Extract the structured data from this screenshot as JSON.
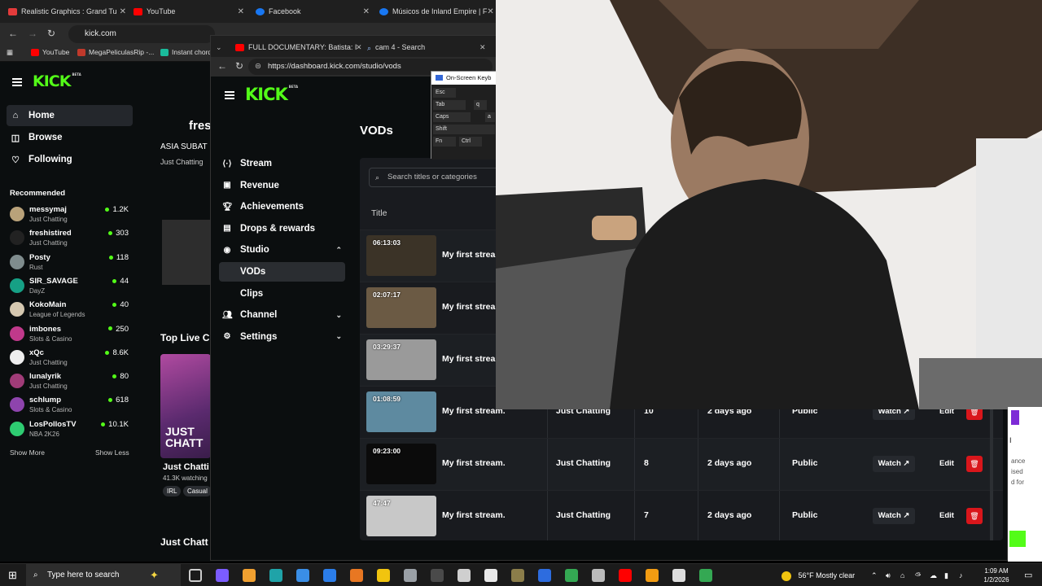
{
  "back_browser": {
    "tabs": [
      {
        "title": "Realistic Graphics : Grand Tu",
        "color": "#e33b3b"
      },
      {
        "title": "YouTube",
        "color": "#ff0000"
      },
      {
        "title": "Facebook",
        "color": "#1877f2"
      },
      {
        "title": "Músicos de Inland Empire | F",
        "color": "#1877f2"
      }
    ],
    "url": "kick.com",
    "bookmarks": [
      {
        "label": "YouTube",
        "color": "#ff0000"
      },
      {
        "label": "MegaPeliculasRip -...",
        "color": "#c0392b"
      },
      {
        "label": "Instant chord...",
        "color": "#1abc9c"
      }
    ],
    "nav": [
      {
        "label": "Home",
        "icon": "house-icon",
        "glyph": "⌂"
      },
      {
        "label": "Browse",
        "icon": "browse-icon",
        "glyph": "◫"
      },
      {
        "label": "Following",
        "icon": "heart-icon",
        "glyph": "♡"
      }
    ],
    "recommended_title": "Recommended",
    "recommended": [
      {
        "name": "messymaj",
        "category": "Just Chatting",
        "viewers": "1.2K",
        "color": "#b9a27a"
      },
      {
        "name": "freshistired",
        "category": "Just Chatting",
        "viewers": "303",
        "color": "#222222"
      },
      {
        "name": "Posty",
        "category": "Rust",
        "viewers": "118",
        "color": "#7f8c8d"
      },
      {
        "name": "SIR_SAVAGE",
        "category": "DayZ",
        "viewers": "44",
        "color": "#16a085"
      },
      {
        "name": "KokoMain",
        "category": "League of Legends",
        "viewers": "40",
        "color": "#d5c8b0"
      },
      {
        "name": "imbones",
        "category": "Slots & Casino",
        "viewers": "250",
        "color": "#c0398b"
      },
      {
        "name": "xQc",
        "category": "Just Chatting",
        "viewers": "8.6K",
        "color": "#eeeeee"
      },
      {
        "name": "lunalyrik",
        "category": "Just Chatting",
        "viewers": "80",
        "color": "#a03c78"
      },
      {
        "name": "schlump",
        "category": "Slots & Casino",
        "viewers": "618",
        "color": "#8e44ad"
      },
      {
        "name": "LosPollosTV",
        "category": "NBA 2K26",
        "viewers": "10.1K",
        "color": "#2ecc71"
      }
    ],
    "show_more": "Show More",
    "show_less": "Show Less",
    "main": {
      "channel_partial": "fres",
      "subtitle_partial": "ASIA SUBAT",
      "category_partial": "Just Chatting",
      "top_live_partial": "Top Live C",
      "card_title_partial": "Just Chatti",
      "card_watching_partial": "41.3K watching",
      "card_tags": [
        "IRL",
        "Casual"
      ],
      "card_overlay": "JUST CHATT",
      "bottom_partial": "Just Chatt"
    }
  },
  "front_browser": {
    "tabs": [
      {
        "title": "FULL DOCUMENTARY: Batista: I W",
        "color": "#ff0000"
      },
      {
        "title": "cam 4 - Search",
        "color": "#5aa0ff"
      }
    ],
    "url": "https://dashboard.kick.com/studio/vods",
    "nav": [
      {
        "label": "Stream",
        "icon": "stream-icon",
        "glyph": "⟨·⟩",
        "chevron": ""
      },
      {
        "label": "Revenue",
        "icon": "revenue-icon",
        "glyph": "▣",
        "chevron": ""
      },
      {
        "label": "Achievements",
        "icon": "trophy-icon",
        "glyph": "🏆︎",
        "chevron": ""
      },
      {
        "label": "Drops & rewards",
        "icon": "gift-icon",
        "glyph": "▤",
        "chevron": ""
      },
      {
        "label": "Studio",
        "icon": "studio-icon",
        "glyph": "◉",
        "chevron": "⌃"
      }
    ],
    "studio_sub": [
      "VODs",
      "Clips"
    ],
    "nav_bottom": [
      {
        "label": "Channel",
        "icon": "channel-icon",
        "glyph": "👥︎",
        "chevron": "⌄"
      },
      {
        "label": "Settings",
        "icon": "settings-icon",
        "glyph": "⚙",
        "chevron": "⌄"
      }
    ],
    "page_title": "VODs",
    "search_placeholder": "Search titles or categories",
    "column_title": "Title",
    "rows": [
      {
        "duration": "06:13:03",
        "title": "My first stream.",
        "category": "",
        "views": "",
        "date": "",
        "visibility": "",
        "thumb": "#3b3327"
      },
      {
        "duration": "02:07:17",
        "title": "My first stream.",
        "category": "",
        "views": "",
        "date": "",
        "visibility": "",
        "thumb": "#6b5a44"
      },
      {
        "duration": "03:29:37",
        "title": "My first stream.",
        "category": "",
        "views": "",
        "date": "",
        "visibility": "",
        "thumb": "#9a9a9a"
      },
      {
        "duration": "01:08:59",
        "title": "My first stream.",
        "category": "Just Chatting",
        "views": "10",
        "date": "2 days ago",
        "visibility": "Public",
        "thumb": "#5e8aa0"
      },
      {
        "duration": "09:23:00",
        "title": "My first stream.",
        "category": "Just Chatting",
        "views": "8",
        "date": "2 days ago",
        "visibility": "Public",
        "thumb": "#0b0b0b"
      },
      {
        "duration": "47:47",
        "title": "My first stream.",
        "category": "Just Chatting",
        "views": "7",
        "date": "2 days ago",
        "visibility": "Public",
        "thumb": "#c8c8c8"
      }
    ],
    "watch_label": "Watch",
    "edit_label": "Edit"
  },
  "osk": {
    "title": "On-Screen Keyb",
    "keys": [
      "Esc",
      "Tab",
      "q",
      "Caps",
      "a",
      "Shift",
      "Fn",
      "Ctrl"
    ]
  },
  "right_strip": [
    "ance",
    "ised",
    "d for",
    "I"
  ],
  "taskbar": {
    "search_placeholder": "Type here to search",
    "weather": "56°F  Mostly clear",
    "time": "1:09 AM",
    "date": "1/2/2026"
  }
}
